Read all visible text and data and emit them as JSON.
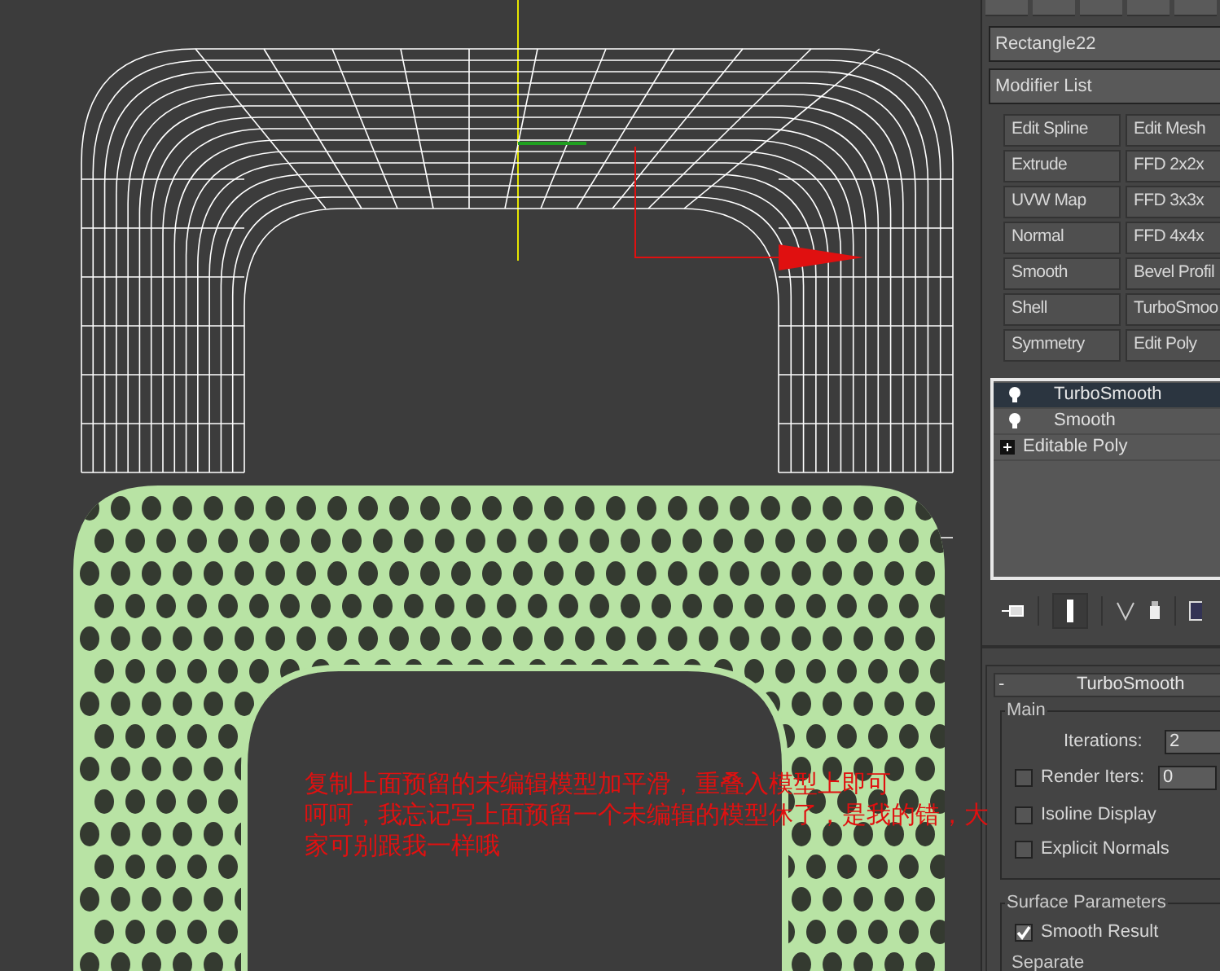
{
  "object_name": "Rectangle22",
  "modifier_list": {
    "label": "Modifier List"
  },
  "modifier_buttons": [
    {
      "label": "Edit Spline"
    },
    {
      "label": "Edit Mesh"
    },
    {
      "label": "Extrude"
    },
    {
      "label": "FFD 2x2x"
    },
    {
      "label": "UVW Map"
    },
    {
      "label": "FFD 3x3x"
    },
    {
      "label": "Normal"
    },
    {
      "label": "FFD 4x4x"
    },
    {
      "label": "Smooth"
    },
    {
      "label": "Bevel Profil"
    },
    {
      "label": "Shell"
    },
    {
      "label": "TurboSmoo"
    },
    {
      "label": "Symmetry"
    },
    {
      "label": "Edit Poly"
    }
  ],
  "modifier_stack": [
    {
      "label": "TurboSmooth",
      "kind": "modifier",
      "selected": true
    },
    {
      "label": "Smooth",
      "kind": "modifier",
      "selected": false
    },
    {
      "label": "Editable Poly",
      "kind": "base",
      "selected": false
    }
  ],
  "rollout": {
    "toggle": "-",
    "title": "TurboSmooth",
    "main_group": "Main",
    "iterations": {
      "label": "Iterations:",
      "value": "2"
    },
    "render_iters": {
      "label": "Render Iters:",
      "value": "0",
      "checked": false
    },
    "checkboxes": [
      {
        "label": "Isoline Display",
        "checked": false
      },
      {
        "label": "Explicit Normals",
        "checked": false
      }
    ],
    "surface_group": "Surface Parameters",
    "smooth_result": {
      "label": "Smooth Result",
      "checked": true
    },
    "separate": "Separate"
  },
  "annotation": [
    "复制上面预留的未编辑模型加平滑，重叠入模型上即可",
    "呵呵，我忘记写上面预留一个未编辑的模型休了，是我的错，大",
    "家可别跟我一样哦"
  ]
}
